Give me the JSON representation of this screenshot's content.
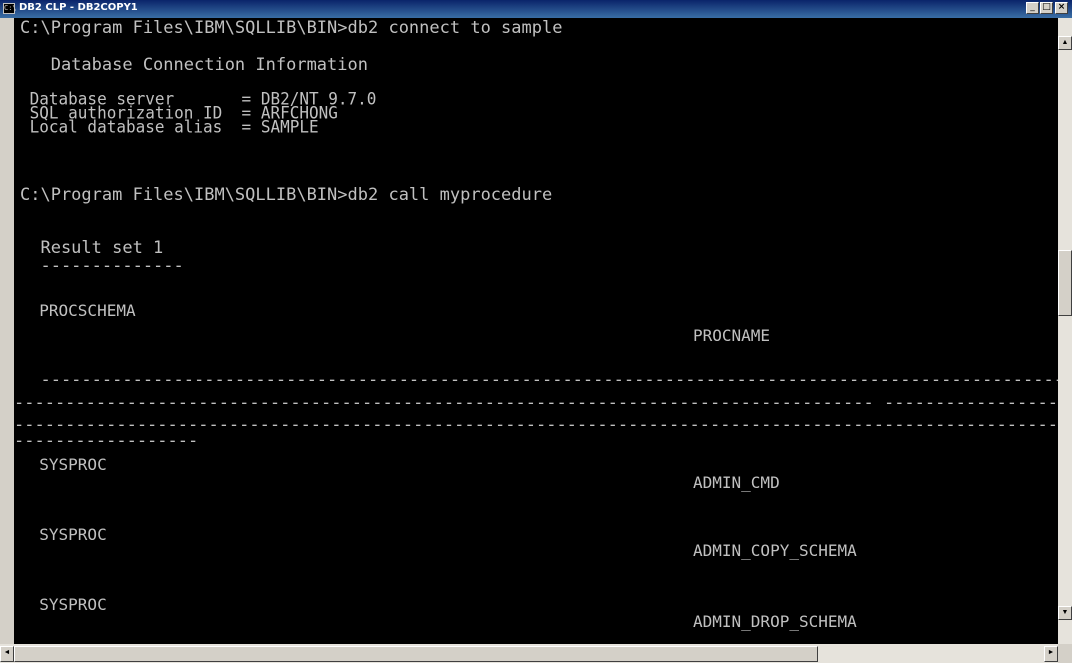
{
  "window": {
    "title": "DB2 CLP - DB2COPY1",
    "icon": "console-icon",
    "controls": [
      "_",
      "□",
      "×"
    ]
  },
  "terminal": {
    "lines": [
      "C:\\Program Files\\IBM\\SQLLIB\\BIN>db2 connect to sample",
      "   Database Connection Information",
      " Database server       = DB2/NT 9.7.0",
      " SQL authorization ID  = ARFCHONG",
      " Local database alias  = SAMPLE",
      "C:\\Program Files\\IBM\\SQLLIB\\BIN>db2 call myprocedure",
      "  Result set 1",
      "  --------------",
      "  PROCSCHEMA",
      "PROCNAME",
      "  --------------------------------------------------------------------------------------------------------------------------------",
      "------------------------------------------------------------------------------------ ----------------------------------------------------------------",
      "--------------------------------------------------------------------------------------------------------------------------------------------------",
      "------------------",
      "  SYSPROC",
      "ADMIN_CMD",
      "  SYSPROC",
      "ADMIN_COPY_SCHEMA",
      "  SYSPROC",
      "ADMIN_DROP_SCHEMA"
    ]
  },
  "scrollbars": {
    "vertical": {
      "up": "▲",
      "down": "▼"
    },
    "horizontal": {
      "left": "◄",
      "right": "►"
    }
  }
}
